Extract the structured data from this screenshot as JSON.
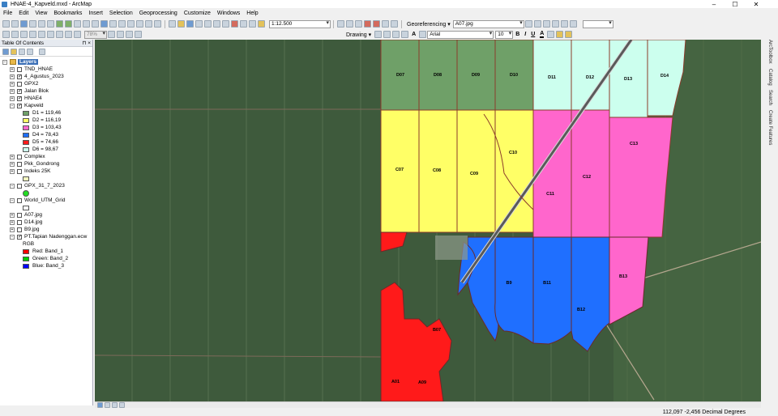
{
  "window": {
    "title": "HNAE-4_Kapveld.mxd - ArcMap",
    "minimize": "–",
    "maximize": "☐",
    "close": "✕"
  },
  "menu": [
    "File",
    "Edit",
    "View",
    "Bookmarks",
    "Insert",
    "Selection",
    "Geoprocessing",
    "Customize",
    "Windows",
    "Help"
  ],
  "toolbar": {
    "scale": "1:12.500",
    "georeferencing_label": "Georeferencing ▾",
    "georef_layer": "A07.jpg",
    "zoom_percent": "78%",
    "drawing_label": "Drawing ▾",
    "font_name": "Arial",
    "font_size": "10",
    "bold": "B",
    "italic": "I",
    "underline": "U",
    "font_color_letter": "A"
  },
  "toc": {
    "title": "Table Of Contents",
    "pin": "⊓ ×",
    "root": "Layers",
    "layers": [
      {
        "name": "TND_HNAE",
        "checked": false
      },
      {
        "name": "4_Agustus_2023",
        "checked": true
      },
      {
        "name": "GPX2",
        "checked": false
      },
      {
        "name": "Jalan Blok",
        "checked": true
      },
      {
        "name": "HNAE4",
        "checked": true
      },
      {
        "name": "Kapveld",
        "checked": true
      }
    ],
    "kapveld_legend": [
      {
        "label": "D1 = 119,46",
        "color": "#6fa068"
      },
      {
        "label": "D2 = 116,19",
        "color": "#ffff66"
      },
      {
        "label": "D3 = 103,43",
        "color": "#ff66cc"
      },
      {
        "label": "D4 = 78,43",
        "color": "#1f6fff"
      },
      {
        "label": "D5 = 74,66",
        "color": "#ff1a1a"
      },
      {
        "label": "D6 = 98,67",
        "color": "#ccffee"
      }
    ],
    "layers2": [
      {
        "name": "Complex",
        "checked": false
      },
      {
        "name": "Pkk_Gondrong",
        "checked": false
      },
      {
        "name": "Indeks 25K",
        "checked": false
      },
      {
        "name": "GPX_31_7_2023",
        "checked": false
      },
      {
        "name": "World_UTM_Grid",
        "checked": false
      },
      {
        "name": "A07.jpg",
        "checked": false
      },
      {
        "name": "D14.jpg",
        "checked": false
      },
      {
        "name": "B9.jpg",
        "checked": false
      },
      {
        "name": "PT.Tapian Nadenggan.ecw",
        "checked": true
      }
    ],
    "rgb_label": "RGB",
    "bands": [
      {
        "label": "Red:   Band_1",
        "color": "#ff0000"
      },
      {
        "label": "Green: Band_2",
        "color": "#00cc00"
      },
      {
        "label": "Blue:  Band_3",
        "color": "#0000ff"
      }
    ]
  },
  "map": {
    "blocks": [
      {
        "label": "D07"
      },
      {
        "label": "D08"
      },
      {
        "label": "D09"
      },
      {
        "label": "D10"
      },
      {
        "label": "D11"
      },
      {
        "label": "D12"
      },
      {
        "label": "D13"
      },
      {
        "label": "D14"
      },
      {
        "label": "C07"
      },
      {
        "label": "C08"
      },
      {
        "label": "C09"
      },
      {
        "label": "C10"
      },
      {
        "label": "C11"
      },
      {
        "label": "C12"
      },
      {
        "label": "C13"
      },
      {
        "label": "B9"
      },
      {
        "label": "B11"
      },
      {
        "label": "B12"
      },
      {
        "label": "B13"
      },
      {
        "label": "B07"
      },
      {
        "label": "A01"
      },
      {
        "label": "A09"
      }
    ],
    "colors": {
      "d1": "#6fa068",
      "d2": "#ffff66",
      "d3": "#ff66cc",
      "d4": "#1f6fff",
      "d5": "#ff1a1a",
      "d6": "#ccffee"
    }
  },
  "right_dock": [
    "ArcToolbox",
    "Catalog",
    "Search",
    "Create Features"
  ],
  "status": {
    "coords": "112,097  -2,456 Decimal Degrees"
  }
}
